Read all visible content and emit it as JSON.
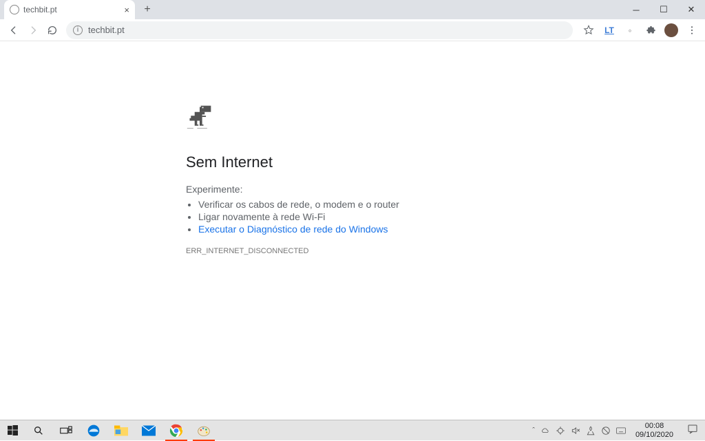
{
  "tab": {
    "title": "techbit.pt"
  },
  "address": {
    "url": "techbit.pt"
  },
  "error": {
    "heading": "Sem Internet",
    "try_label": "Experimente:",
    "suggestions": [
      "Verificar os cabos de rede, o modem e o router",
      "Ligar novamente à rede Wi-Fi"
    ],
    "diagnostics_link": "Executar o Diagnóstico de rede do Windows",
    "code": "ERR_INTERNET_DISCONNECTED"
  },
  "taskbar": {
    "time": "00:08",
    "date": "09/10/2020"
  }
}
